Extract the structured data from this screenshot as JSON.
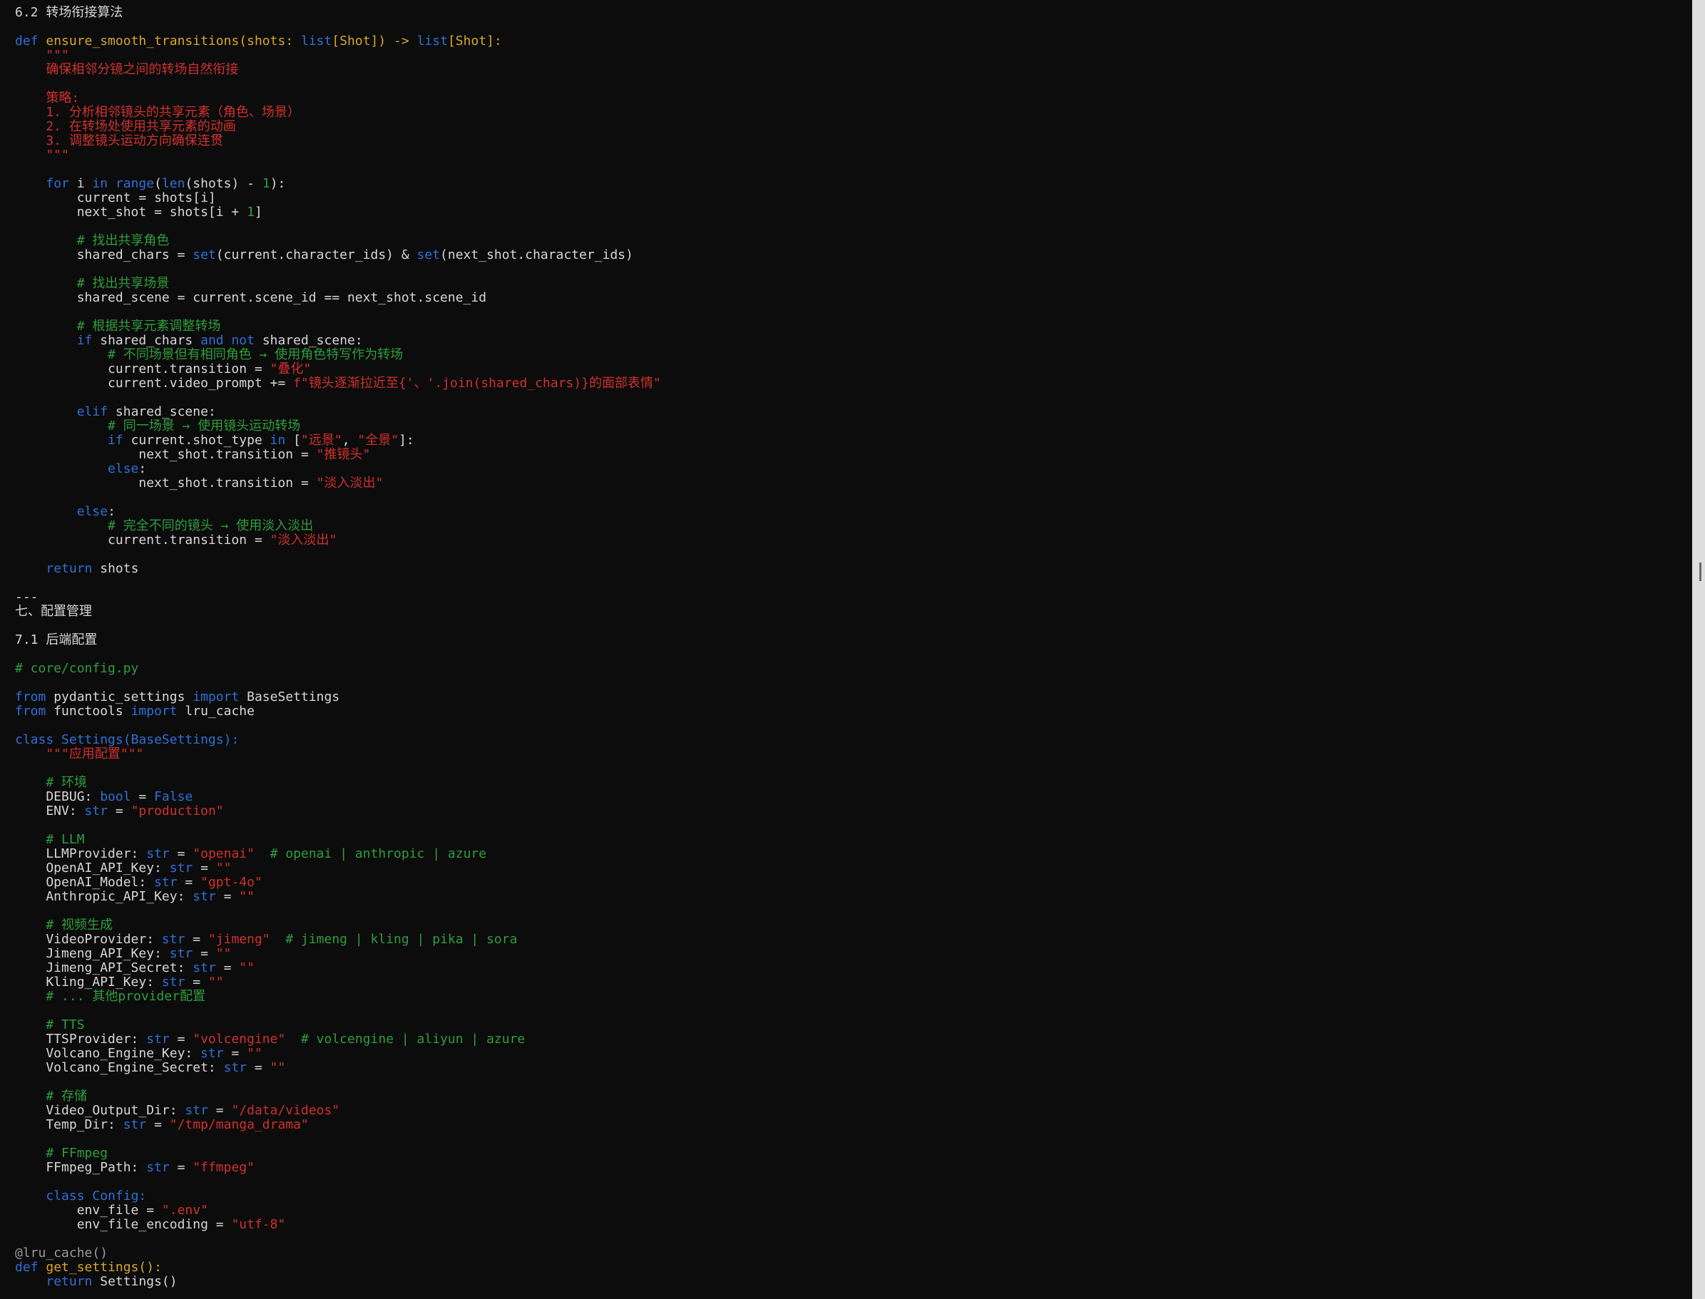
{
  "document": {
    "lines": [
      [
        {
          "t": "6.2 转场衔接算法"
        }
      ],
      [],
      [
        {
          "t": "def",
          "k": "k"
        },
        {
          "t": " "
        },
        {
          "t": "ensure_smooth_transitions",
          "k": "f"
        },
        {
          "t": "(shots: ",
          "k": "f"
        },
        {
          "t": "list",
          "k": "k"
        },
        {
          "t": "[Shot]) -> ",
          "k": "f"
        },
        {
          "t": "list",
          "k": "k"
        },
        {
          "t": "[Shot]:",
          "k": "f"
        }
      ],
      [
        {
          "t": "    \"\"\"",
          "k": "s"
        }
      ],
      [
        {
          "t": "    确保相邻分镜之间的转场自然衔接",
          "k": "s"
        }
      ],
      [],
      [
        {
          "t": "    策略:",
          "k": "s"
        }
      ],
      [
        {
          "t": "    1. 分析相邻镜头的共享元素（角色、场景）",
          "k": "s"
        }
      ],
      [
        {
          "t": "    2. 在转场处使用共享元素的动画",
          "k": "s"
        }
      ],
      [
        {
          "t": "    3. 调整镜头运动方向确保连贯",
          "k": "s"
        }
      ],
      [
        {
          "t": "    \"\"\"",
          "k": "s"
        }
      ],
      [],
      [
        {
          "t": "    "
        },
        {
          "t": "for",
          "k": "k"
        },
        {
          "t": " i "
        },
        {
          "t": "in",
          "k": "k"
        },
        {
          "t": " "
        },
        {
          "t": "range",
          "k": "k"
        },
        {
          "t": "("
        },
        {
          "t": "len",
          "k": "k"
        },
        {
          "t": "(shots) - "
        },
        {
          "t": "1",
          "k": "c"
        },
        {
          "t": "):"
        }
      ],
      [
        {
          "t": "        current = shots[i]"
        }
      ],
      [
        {
          "t": "        next_shot = shots[i + "
        },
        {
          "t": "1",
          "k": "c"
        },
        {
          "t": "]"
        }
      ],
      [],
      [
        {
          "t": "        # 找出共享角色",
          "k": "c"
        }
      ],
      [
        {
          "t": "        shared_chars = "
        },
        {
          "t": "set",
          "k": "k"
        },
        {
          "t": "(current.character_ids) & "
        },
        {
          "t": "set",
          "k": "k"
        },
        {
          "t": "(next_shot.character_ids)"
        }
      ],
      [],
      [
        {
          "t": "        # 找出共享场景",
          "k": "c"
        }
      ],
      [
        {
          "t": "        shared_scene = current.scene_id == next_shot.scene_id"
        }
      ],
      [],
      [
        {
          "t": "        # 根据共享元素调整转场",
          "k": "c"
        }
      ],
      [
        {
          "t": "        "
        },
        {
          "t": "if",
          "k": "k"
        },
        {
          "t": " shared_chars "
        },
        {
          "t": "and",
          "k": "k"
        },
        {
          "t": " "
        },
        {
          "t": "not",
          "k": "k"
        },
        {
          "t": " shared_scene:"
        }
      ],
      [
        {
          "t": "            # 不同场景但有相同角色 → 使用角色特写作为转场",
          "k": "c"
        }
      ],
      [
        {
          "t": "            current.transition = "
        },
        {
          "t": "\"叠化\"",
          "k": "s"
        }
      ],
      [
        {
          "t": "            current.video_prompt += "
        },
        {
          "t": "f\"镜头逐渐拉近至{'、'.join(shared_chars)}的面部表情\"",
          "k": "s"
        }
      ],
      [],
      [
        {
          "t": "        "
        },
        {
          "t": "elif",
          "k": "k"
        },
        {
          "t": " shared_scene:"
        }
      ],
      [
        {
          "t": "            # 同一场景 → 使用镜头运动转场",
          "k": "c"
        }
      ],
      [
        {
          "t": "            "
        },
        {
          "t": "if",
          "k": "k"
        },
        {
          "t": " current.shot_type "
        },
        {
          "t": "in",
          "k": "k"
        },
        {
          "t": " ["
        },
        {
          "t": "\"远景\"",
          "k": "s"
        },
        {
          "t": ", "
        },
        {
          "t": "\"全景\"",
          "k": "s"
        },
        {
          "t": "]:"
        }
      ],
      [
        {
          "t": "                next_shot.transition = "
        },
        {
          "t": "\"推镜头\"",
          "k": "s"
        }
      ],
      [
        {
          "t": "            "
        },
        {
          "t": "else",
          "k": "k"
        },
        {
          "t": ":"
        }
      ],
      [
        {
          "t": "                next_shot.transition = "
        },
        {
          "t": "\"淡入淡出\"",
          "k": "s"
        }
      ],
      [],
      [
        {
          "t": "        "
        },
        {
          "t": "else",
          "k": "k"
        },
        {
          "t": ":"
        }
      ],
      [
        {
          "t": "            # 完全不同的镜头 → 使用淡入淡出",
          "k": "c"
        }
      ],
      [
        {
          "t": "            current.transition = "
        },
        {
          "t": "\"淡入淡出\"",
          "k": "s"
        }
      ],
      [],
      [
        {
          "t": "    "
        },
        {
          "t": "return",
          "k": "k"
        },
        {
          "t": " shots"
        }
      ],
      [],
      [
        {
          "t": "---"
        }
      ],
      [
        {
          "t": "七、配置管理"
        }
      ],
      [],
      [
        {
          "t": "7.1 后端配置"
        }
      ],
      [],
      [
        {
          "t": "# core/config.py",
          "k": "c"
        }
      ],
      [],
      [
        {
          "t": "from",
          "k": "k"
        },
        {
          "t": " pydantic_settings "
        },
        {
          "t": "import",
          "k": "k"
        },
        {
          "t": " BaseSettings"
        }
      ],
      [
        {
          "t": "from",
          "k": "k"
        },
        {
          "t": " functools "
        },
        {
          "t": "import",
          "k": "k"
        },
        {
          "t": " lru_cache"
        }
      ],
      [],
      [
        {
          "t": "class",
          "k": "k"
        },
        {
          "t": " "
        },
        {
          "t": "Settings(BaseSettings):",
          "k": "k"
        }
      ],
      [
        {
          "t": "    \"\"\"应用配置\"\"\"",
          "k": "s"
        }
      ],
      [],
      [
        {
          "t": "    # 环境",
          "k": "c"
        }
      ],
      [
        {
          "t": "    DEBUG: "
        },
        {
          "t": "bool",
          "k": "k"
        },
        {
          "t": " = "
        },
        {
          "t": "False",
          "k": "k"
        }
      ],
      [
        {
          "t": "    ENV: "
        },
        {
          "t": "str",
          "k": "k"
        },
        {
          "t": " = "
        },
        {
          "t": "\"production\"",
          "k": "s"
        }
      ],
      [],
      [
        {
          "t": "    # LLM",
          "k": "c"
        }
      ],
      [
        {
          "t": "    LLMProvider: "
        },
        {
          "t": "str",
          "k": "k"
        },
        {
          "t": " = "
        },
        {
          "t": "\"openai\"",
          "k": "s"
        },
        {
          "t": "  "
        },
        {
          "t": "# openai | anthropic | azure",
          "k": "c"
        }
      ],
      [
        {
          "t": "    OpenAI_API_Key: "
        },
        {
          "t": "str",
          "k": "k"
        },
        {
          "t": " = "
        },
        {
          "t": "\"\"",
          "k": "s"
        }
      ],
      [
        {
          "t": "    OpenAI_Model: "
        },
        {
          "t": "str",
          "k": "k"
        },
        {
          "t": " = "
        },
        {
          "t": "\"gpt-4o\"",
          "k": "s"
        }
      ],
      [
        {
          "t": "    Anthropic_API_Key: "
        },
        {
          "t": "str",
          "k": "k"
        },
        {
          "t": " = "
        },
        {
          "t": "\"\"",
          "k": "s"
        }
      ],
      [],
      [
        {
          "t": "    # 视频生成",
          "k": "c"
        }
      ],
      [
        {
          "t": "    VideoProvider: "
        },
        {
          "t": "str",
          "k": "k"
        },
        {
          "t": " = "
        },
        {
          "t": "\"jimeng\"",
          "k": "s"
        },
        {
          "t": "  "
        },
        {
          "t": "# jimeng | kling | pika | sora",
          "k": "c"
        }
      ],
      [
        {
          "t": "    Jimeng_API_Key: "
        },
        {
          "t": "str",
          "k": "k"
        },
        {
          "t": " = "
        },
        {
          "t": "\"\"",
          "k": "s"
        }
      ],
      [
        {
          "t": "    Jimeng_API_Secret: "
        },
        {
          "t": "str",
          "k": "k"
        },
        {
          "t": " = "
        },
        {
          "t": "\"\"",
          "k": "s"
        }
      ],
      [
        {
          "t": "    Kling_API_Key: "
        },
        {
          "t": "str",
          "k": "k"
        },
        {
          "t": " = "
        },
        {
          "t": "\"\"",
          "k": "s"
        }
      ],
      [
        {
          "t": "    # ... 其他provider配置",
          "k": "c"
        }
      ],
      [],
      [
        {
          "t": "    # TTS",
          "k": "c"
        }
      ],
      [
        {
          "t": "    TTSProvider: "
        },
        {
          "t": "str",
          "k": "k"
        },
        {
          "t": " = "
        },
        {
          "t": "\"volcengine\"",
          "k": "s"
        },
        {
          "t": "  "
        },
        {
          "t": "# volcengine | aliyun | azure",
          "k": "c"
        }
      ],
      [
        {
          "t": "    Volcano_Engine_Key: "
        },
        {
          "t": "str",
          "k": "k"
        },
        {
          "t": " = "
        },
        {
          "t": "\"\"",
          "k": "s"
        }
      ],
      [
        {
          "t": "    Volcano_Engine_Secret: "
        },
        {
          "t": "str",
          "k": "k"
        },
        {
          "t": " = "
        },
        {
          "t": "\"\"",
          "k": "s"
        }
      ],
      [],
      [
        {
          "t": "    # 存储",
          "k": "c"
        }
      ],
      [
        {
          "t": "    Video_Output_Dir: "
        },
        {
          "t": "str",
          "k": "k"
        },
        {
          "t": " = "
        },
        {
          "t": "\"/data/videos\"",
          "k": "s"
        }
      ],
      [
        {
          "t": "    Temp_Dir: "
        },
        {
          "t": "str",
          "k": "k"
        },
        {
          "t": " = "
        },
        {
          "t": "\"/tmp/manga_drama\"",
          "k": "s"
        }
      ],
      [],
      [
        {
          "t": "    # FFmpeg",
          "k": "c"
        }
      ],
      [
        {
          "t": "    FFmpeg_Path: "
        },
        {
          "t": "str",
          "k": "k"
        },
        {
          "t": " = "
        },
        {
          "t": "\"ffmpeg\"",
          "k": "s"
        }
      ],
      [],
      [
        {
          "t": "    "
        },
        {
          "t": "class",
          "k": "k"
        },
        {
          "t": " "
        },
        {
          "t": "Config:",
          "k": "k"
        }
      ],
      [
        {
          "t": "        env_file = "
        },
        {
          "t": "\".env\"",
          "k": "s"
        }
      ],
      [
        {
          "t": "        env_file_encoding = "
        },
        {
          "t": "\"utf-8\"",
          "k": "s"
        }
      ],
      [],
      [
        {
          "t": "@lru_cache()",
          "k": "d"
        }
      ],
      [
        {
          "t": "def",
          "k": "k"
        },
        {
          "t": " "
        },
        {
          "t": "get_settings():",
          "k": "f"
        }
      ],
      [
        {
          "t": "    "
        },
        {
          "t": "return",
          "k": "k"
        },
        {
          "t": " Settings()"
        }
      ]
    ]
  },
  "colors": {
    "background": "#0c0c0c",
    "text": "#d7d7d7",
    "keyword": "#2f6fd8",
    "function": "#d8a62a",
    "string": "#d0312d",
    "comment": "#2f9e3c",
    "decorator": "#9a9a9a",
    "scrollbar_track": "#dedede"
  },
  "scroll": {
    "position": 0.44
  }
}
